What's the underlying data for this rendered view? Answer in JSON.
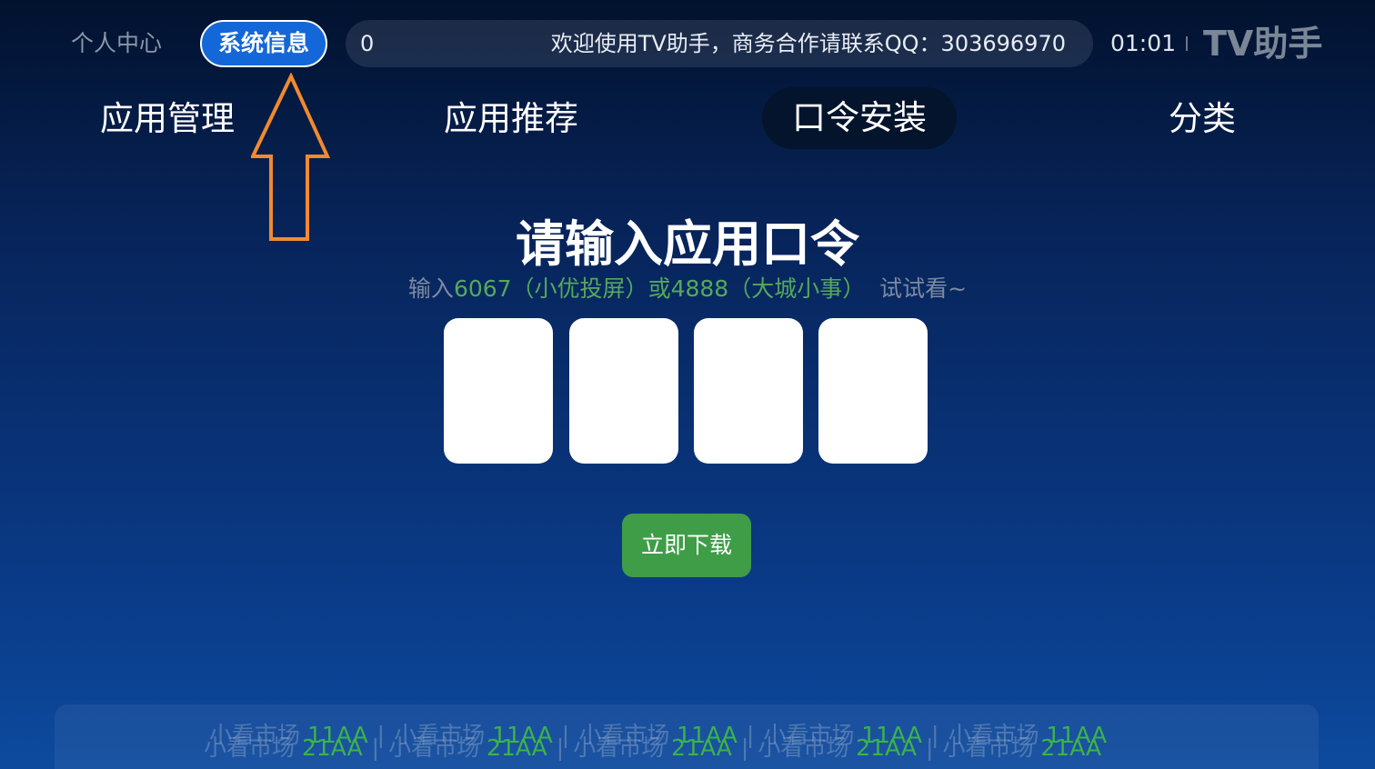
{
  "topbar": {
    "personal_center": "个人中心",
    "system_info": "系统信息",
    "ticker_left": "0",
    "ticker_message": "欢迎使用TV助手，商务合作请联系QQ：303696970",
    "clock": "01:01",
    "brand": "TV助手"
  },
  "tabs": [
    {
      "label": "应用管理"
    },
    {
      "label": "应用推荐"
    },
    {
      "label": "口令安装",
      "focused": true
    },
    {
      "label": "分类"
    }
  ],
  "main": {
    "heading": "请输入应用口令",
    "hint_prefix": "输入",
    "hint_code1": "6067（小优投屏）",
    "hint_or": "或",
    "hint_code2": "4888（大城小事）",
    "hint_suffix": "试试看~",
    "code_slots": [
      "",
      "",
      "",
      ""
    ],
    "download_button": "立即下载"
  },
  "footer": {
    "row1_name": "小看市场",
    "row1_code": "11AA",
    "row2_name": "小看市场",
    "row2_code": "21AA",
    "repeat": 5
  },
  "colors": {
    "accent_blue": "#1467d8",
    "download_green": "#3f9d48",
    "arrow_orange": "#f28a2e",
    "hint_green": "#55a85d"
  }
}
